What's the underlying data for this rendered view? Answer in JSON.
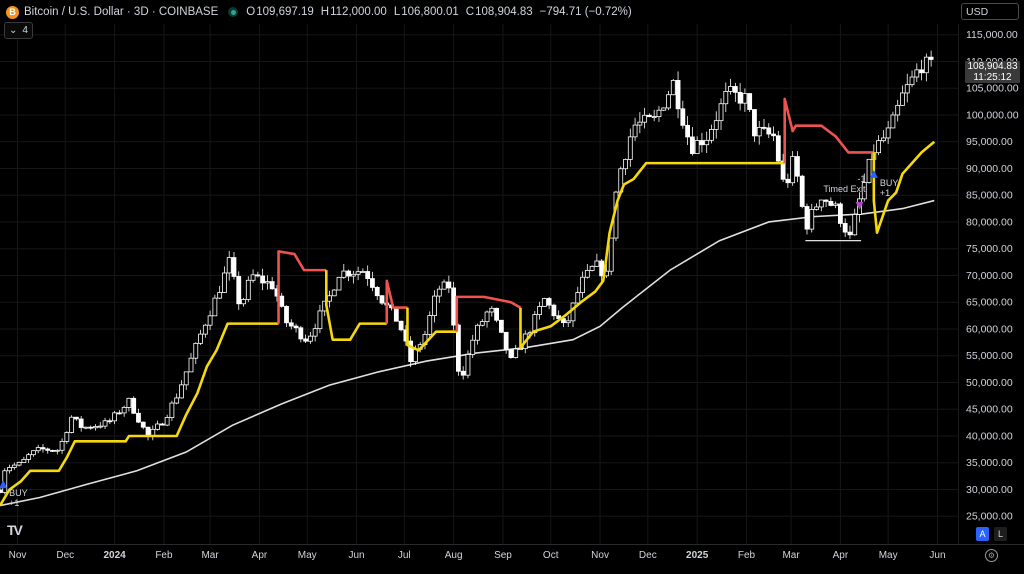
{
  "header": {
    "symbol_title": "Bitcoin / U.S. Dollar · 3D · COINBASE",
    "logo_text": "B",
    "open_label": "O",
    "open": "109,697.19",
    "high_label": "H",
    "high": "112,000.00",
    "low_label": "L",
    "low": "106,800.01",
    "close_label": "C",
    "close": "108,904.83",
    "change": "−794.71 (−0.72%)",
    "indicator_count": "4"
  },
  "currency": "USD",
  "last_price": {
    "price": "108,904.83",
    "countdown": "11:25:12"
  },
  "axis_buttons": {
    "auto": "A",
    "log": "L"
  },
  "tv_logo": "TV",
  "colors": {
    "background": "#000000",
    "candle": "#ffffff",
    "supertrend_up": "#f5d90a",
    "supertrend_down": "#ef5350",
    "moving_average": "#e0e0e0",
    "buy_marker": "#2962ff",
    "exit_marker": "#ab47bc",
    "axis_text": "#d1d4dc",
    "grid": "#161616"
  },
  "chart_data": {
    "type": "candlestick",
    "yticks": [
      25000,
      30000,
      35000,
      40000,
      45000,
      50000,
      55000,
      60000,
      65000,
      70000,
      75000,
      80000,
      85000,
      90000,
      95000,
      100000,
      105000,
      110000,
      115000
    ],
    "ytick_labels": [
      "25,000.00",
      "30,000.00",
      "35,000.00",
      "40,000.00",
      "45,000.00",
      "50,000.00",
      "55,000.00",
      "60,000.00",
      "65,000.00",
      "70,000.00",
      "75,000.00",
      "80,000.00",
      "85,000.00",
      "90,000.00",
      "95,000.00",
      "100,000.00",
      "105,000.00",
      "110,000.00",
      "115,000.00"
    ],
    "ylim": [
      20000,
      117000
    ],
    "xlim": [
      "2023-10-21",
      "2025-06-12"
    ],
    "xticks": [
      {
        "date": "2023-11-01",
        "label": "Nov",
        "bold": false
      },
      {
        "date": "2023-12-01",
        "label": "Dec",
        "bold": false
      },
      {
        "date": "2024-01-01",
        "label": "2024",
        "bold": true
      },
      {
        "date": "2024-02-01",
        "label": "Feb",
        "bold": false
      },
      {
        "date": "2024-03-01",
        "label": "Mar",
        "bold": false
      },
      {
        "date": "2024-04-01",
        "label": "Apr",
        "bold": false
      },
      {
        "date": "2024-05-01",
        "label": "May",
        "bold": false
      },
      {
        "date": "2024-06-01",
        "label": "Jun",
        "bold": false
      },
      {
        "date": "2024-07-01",
        "label": "Jul",
        "bold": false
      },
      {
        "date": "2024-08-01",
        "label": "Aug",
        "bold": false
      },
      {
        "date": "2024-09-01",
        "label": "Sep",
        "bold": false
      },
      {
        "date": "2024-10-01",
        "label": "Oct",
        "bold": false
      },
      {
        "date": "2024-11-01",
        "label": "Nov",
        "bold": false
      },
      {
        "date": "2024-12-01",
        "label": "Dec",
        "bold": false
      },
      {
        "date": "2025-01-01",
        "label": "2025",
        "bold": true
      },
      {
        "date": "2025-02-01",
        "label": "Feb",
        "bold": false
      },
      {
        "date": "2025-03-01",
        "label": "Mar",
        "bold": false
      },
      {
        "date": "2025-04-01",
        "label": "Apr",
        "bold": false
      },
      {
        "date": "2025-05-01",
        "label": "May",
        "bold": false
      },
      {
        "date": "2025-06-01",
        "label": "Jun",
        "bold": false
      }
    ],
    "close_path": [
      [
        "2023-10-21",
        29900
      ],
      [
        "2023-10-24",
        33800
      ],
      [
        "2023-10-27",
        34300
      ],
      [
        "2023-11-03",
        34800
      ],
      [
        "2023-11-09",
        36600
      ],
      [
        "2023-11-15",
        37500
      ],
      [
        "2023-11-27",
        37400
      ],
      [
        "2023-12-05",
        43500
      ],
      [
        "2023-12-12",
        41500
      ],
      [
        "2023-12-28",
        42500
      ],
      [
        "2024-01-10",
        46500
      ],
      [
        "2024-01-22",
        39800
      ],
      [
        "2024-02-01",
        43000
      ],
      [
        "2024-02-09",
        47500
      ],
      [
        "2024-02-15",
        52000
      ],
      [
        "2024-02-28",
        62000
      ],
      [
        "2024-03-05",
        66000
      ],
      [
        "2024-03-13",
        72500
      ],
      [
        "2024-03-20",
        64000
      ],
      [
        "2024-03-27",
        70000
      ],
      [
        "2024-04-10",
        68000
      ],
      [
        "2024-04-17",
        61500
      ],
      [
        "2024-05-01",
        58000
      ],
      [
        "2024-05-15",
        66000
      ],
      [
        "2024-05-21",
        70500
      ],
      [
        "2024-06-06",
        71000
      ],
      [
        "2024-06-18",
        65000
      ],
      [
        "2024-06-28",
        61000
      ],
      [
        "2024-07-05",
        54000
      ],
      [
        "2024-07-14",
        59000
      ],
      [
        "2024-07-22",
        67500
      ],
      [
        "2024-07-29",
        68000
      ],
      [
        "2024-08-05",
        50000
      ],
      [
        "2024-08-14",
        59000
      ],
      [
        "2024-08-24",
        64000
      ],
      [
        "2024-09-06",
        54000
      ],
      [
        "2024-09-18",
        60000
      ],
      [
        "2024-09-27",
        65500
      ],
      [
        "2024-10-10",
        60000
      ],
      [
        "2024-10-20",
        68500
      ],
      [
        "2024-10-29",
        72000
      ],
      [
        "2024-11-05",
        70000
      ],
      [
        "2024-11-12",
        88000
      ],
      [
        "2024-11-22",
        98000
      ],
      [
        "2024-12-05",
        99000
      ],
      [
        "2024-12-17",
        106000
      ],
      [
        "2024-12-28",
        94000
      ],
      [
        "2025-01-07",
        96000
      ],
      [
        "2025-01-20",
        104000
      ],
      [
        "2025-01-31",
        103000
      ],
      [
        "2025-02-06",
        97000
      ],
      [
        "2025-02-18",
        96000
      ],
      [
        "2025-02-25",
        86000
      ],
      [
        "2025-03-03",
        92000
      ],
      [
        "2025-03-10",
        79000
      ],
      [
        "2025-03-20",
        85000
      ],
      [
        "2025-03-29",
        82500
      ],
      [
        "2025-04-07",
        77000
      ],
      [
        "2025-04-13",
        84000
      ],
      [
        "2025-04-22",
        93500
      ],
      [
        "2025-05-02",
        97000
      ],
      [
        "2025-05-10",
        103500
      ],
      [
        "2025-05-22",
        109500
      ],
      [
        "2025-05-28",
        108900
      ]
    ],
    "series": [
      {
        "name": "",
        "style": "supertrend",
        "segments": [
          {
            "trend": "up",
            "points": [
              [
                "2023-10-21",
                27000
              ],
              [
                "2023-10-27",
                30000
              ],
              [
                "2023-11-03",
                31500
              ],
              [
                "2023-11-09",
                33500
              ],
              [
                "2023-11-27",
                33500
              ],
              [
                "2023-12-02",
                36000
              ],
              [
                "2023-12-07",
                39000
              ],
              [
                "2024-01-08",
                39000
              ],
              [
                "2024-01-10",
                40000
              ],
              [
                "2024-02-09",
                40000
              ],
              [
                "2024-02-15",
                44000
              ],
              [
                "2024-02-22",
                48000
              ],
              [
                "2024-02-28",
                53000
              ],
              [
                "2024-03-05",
                56000
              ],
              [
                "2024-03-12",
                61000
              ],
              [
                "2024-04-13",
                61000
              ]
            ]
          },
          {
            "trend": "down",
            "points": [
              [
                "2024-04-13",
                61000
              ],
              [
                "2024-04-13",
                74500
              ],
              [
                "2024-04-23",
                74000
              ],
              [
                "2024-04-29",
                71000
              ],
              [
                "2024-05-13",
                71000
              ]
            ]
          },
          {
            "trend": "up",
            "points": [
              [
                "2024-05-13",
                71000
              ],
              [
                "2024-05-13",
                64500
              ],
              [
                "2024-05-17",
                58000
              ],
              [
                "2024-05-28",
                58000
              ],
              [
                "2024-06-03",
                61000
              ],
              [
                "2024-06-20",
                61000
              ]
            ]
          },
          {
            "trend": "down",
            "points": [
              [
                "2024-06-20",
                61000
              ],
              [
                "2024-06-20",
                69000
              ],
              [
                "2024-06-24",
                64000
              ],
              [
                "2024-07-03",
                64000
              ]
            ]
          },
          {
            "trend": "up",
            "points": [
              [
                "2024-07-03",
                64000
              ],
              [
                "2024-07-03",
                57000
              ],
              [
                "2024-07-10",
                56000
              ],
              [
                "2024-07-21",
                59500
              ],
              [
                "2024-08-03",
                59500
              ]
            ]
          },
          {
            "trend": "down",
            "points": [
              [
                "2024-08-03",
                59500
              ],
              [
                "2024-08-03",
                66000
              ],
              [
                "2024-08-20",
                66000
              ],
              [
                "2024-09-06",
                65000
              ],
              [
                "2024-09-12",
                64000
              ]
            ]
          },
          {
            "trend": "up",
            "points": [
              [
                "2024-09-12",
                64000
              ],
              [
                "2024-09-12",
                56500
              ],
              [
                "2024-09-20",
                59500
              ],
              [
                "2024-10-01",
                60500
              ],
              [
                "2024-10-10",
                62500
              ],
              [
                "2024-10-20",
                65000
              ],
              [
                "2024-10-29",
                67000
              ],
              [
                "2024-11-03",
                69000
              ],
              [
                "2024-11-07",
                78000
              ],
              [
                "2024-11-12",
                84000
              ],
              [
                "2024-11-16",
                87000
              ],
              [
                "2024-11-22",
                88000
              ],
              [
                "2024-11-30",
                91000
              ],
              [
                "2025-02-25",
                91000
              ]
            ]
          },
          {
            "trend": "down",
            "points": [
              [
                "2025-02-25",
                91000
              ],
              [
                "2025-02-25",
                103000
              ],
              [
                "2025-03-02",
                97000
              ],
              [
                "2025-03-04",
                98000
              ],
              [
                "2025-03-20",
                98000
              ],
              [
                "2025-03-29",
                96000
              ],
              [
                "2025-04-06",
                93000
              ],
              [
                "2025-04-22",
                93000
              ]
            ]
          },
          {
            "trend": "up",
            "points": [
              [
                "2025-04-22",
                93000
              ],
              [
                "2025-04-22",
                84000
              ],
              [
                "2025-04-24",
                78000
              ],
              [
                "2025-05-01",
                84000
              ],
              [
                "2025-05-06",
                85500
              ],
              [
                "2025-05-10",
                89000
              ],
              [
                "2025-05-16",
                91000
              ],
              [
                "2025-05-22",
                93000
              ],
              [
                "2025-05-30",
                95000
              ]
            ]
          }
        ]
      },
      {
        "name": "",
        "style": "moving-average",
        "points": [
          [
            "2023-10-21",
            27000
          ],
          [
            "2023-11-15",
            28500
          ],
          [
            "2023-12-15",
            31000
          ],
          [
            "2024-01-15",
            33500
          ],
          [
            "2024-02-15",
            37000
          ],
          [
            "2024-03-15",
            42000
          ],
          [
            "2024-04-15",
            46000
          ],
          [
            "2024-05-15",
            49500
          ],
          [
            "2024-06-15",
            52000
          ],
          [
            "2024-07-15",
            54000
          ],
          [
            "2024-08-15",
            55500
          ],
          [
            "2024-09-15",
            56500
          ],
          [
            "2024-10-15",
            58000
          ],
          [
            "2024-11-01",
            60500
          ],
          [
            "2024-11-15",
            64000
          ],
          [
            "2024-12-15",
            71000
          ],
          [
            "2025-01-15",
            76500
          ],
          [
            "2025-02-15",
            80000
          ],
          [
            "2025-03-15",
            81000
          ],
          [
            "2025-04-15",
            81500
          ],
          [
            "2025-05-10",
            82500
          ],
          [
            "2025-05-30",
            84000
          ]
        ]
      }
    ],
    "support_line": {
      "x1": "2025-03-10",
      "x2": "2025-04-14",
      "y": 76500
    },
    "annotations": [
      {
        "date": "2023-10-23",
        "price": 31000,
        "kind": "buy",
        "text": "BUY",
        "sub": "+1"
      },
      {
        "date": "2025-04-13",
        "price": 83000,
        "kind": "exit",
        "text": "Timed Exit",
        "sub": "-1"
      },
      {
        "date": "2025-04-22",
        "price": 89000,
        "kind": "buy",
        "text": "BUY",
        "sub": "+1"
      }
    ]
  }
}
